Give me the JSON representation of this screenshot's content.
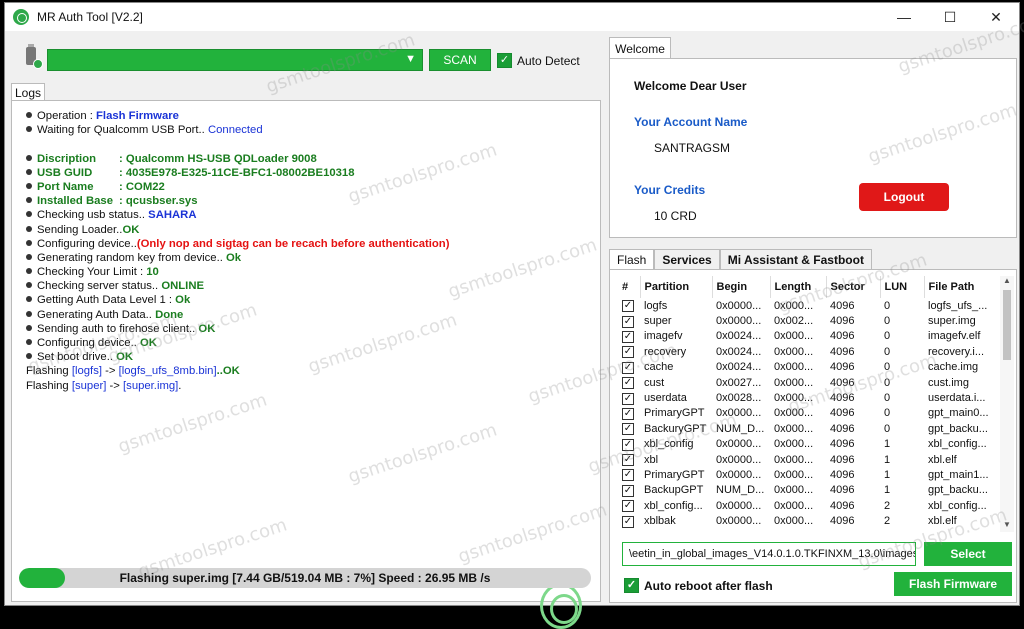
{
  "window": {
    "title": "MR Auth Tool [V2.2]",
    "minimize": "—",
    "maximize": "☐",
    "close": "✕"
  },
  "toolbar": {
    "scan_label": "SCAN",
    "auto_detect_label": "Auto Detect",
    "auto_detect_checked": true
  },
  "logs": {
    "tab_label": "Logs",
    "op_label": "Operation : ",
    "op_value": "Flash Firmware",
    "waiting_label": "Waiting for Qualcomm USB Port..",
    "waiting_value": "Connected",
    "desc_label": "Discription",
    "desc_value": ": Qualcomm HS-USB QDLoader 9008",
    "guid_label": "USB GUID",
    "guid_value": ": 4035E978-E325-11CE-BFC1-08002BE10318",
    "port_label": "Port Name",
    "port_value": ": COM22",
    "base_label": "Installed Base",
    "base_value": ": qcusbser.sys",
    "usb_status_label": "Checking usb status.. ",
    "usb_status_value": "SAHARA",
    "loader_label": "Sending Loader..",
    "loader_value": "OK",
    "config_label": "Configuring device..",
    "config_value": "(Only nop and sigtag can be recach before authentication)",
    "randkey_label": "Generating random key from device.. ",
    "randkey_value": "Ok",
    "limit_label": "Checking Your Limit : ",
    "limit_value": "10",
    "server_label": "Checking server status.. ",
    "server_value": "ONLINE",
    "authlvl_label": "Getting Auth Data Level 1 : ",
    "authlvl_value": "Ok",
    "gen_auth_label": "Generating Auth Data.. ",
    "gen_auth_value": "Done",
    "send_auth_label": "Sending auth to firehose client.. ",
    "send_auth_value": "OK",
    "config2_label": "Configuring device.. ",
    "config2_value": "OK",
    "boot_label": "Set boot drive.. ",
    "boot_value": "OK",
    "flash1_a": "Flashing ",
    "flash1_b": "[logfs]",
    "flash1_c": " -> ",
    "flash1_d": "[logfs_ufs_8mb.bin]",
    "flash1_e": "..OK",
    "flash2_a": "Flashing ",
    "flash2_b": "[super]",
    "flash2_c": " -> ",
    "flash2_d": "[super.img]",
    "flash2_e": "."
  },
  "progress": {
    "text": "Flashing super.img [7.44 GB/519.04 MB : 7%] Speed : 26.95 MB /s",
    "percent": 8
  },
  "welcome": {
    "tab_label": "Welcome",
    "greeting": "Welcome Dear User",
    "account_label": "Your Account Name",
    "account_value": "SANTRAGSM",
    "credits_label": "Your Credits",
    "credits_value": "10 CRD",
    "logout_label": "Logout"
  },
  "flash_tabs": [
    "Flash",
    "Services",
    "Mi Assistant & Fastboot"
  ],
  "partition_table": {
    "headers": [
      "#",
      "Partition",
      "Begin",
      "Length",
      "Sector",
      "LUN",
      "File Path"
    ],
    "rows": [
      [
        "logfs",
        "0x0000...",
        "0x000...",
        "4096",
        "0",
        "logfs_ufs_..."
      ],
      [
        "super",
        "0x0000...",
        "0x002...",
        "4096",
        "0",
        "super.img"
      ],
      [
        "imagefv",
        "0x0024...",
        "0x000...",
        "4096",
        "0",
        "imagefv.elf"
      ],
      [
        "recovery",
        "0x0024...",
        "0x000...",
        "4096",
        "0",
        "recovery.i..."
      ],
      [
        "cache",
        "0x0024...",
        "0x000...",
        "4096",
        "0",
        "cache.img"
      ],
      [
        "cust",
        "0x0027...",
        "0x000...",
        "4096",
        "0",
        "cust.img"
      ],
      [
        "userdata",
        "0x0028...",
        "0x000...",
        "4096",
        "0",
        "userdata.i..."
      ],
      [
        "PrimaryGPT",
        "0x0000...",
        "0x000...",
        "4096",
        "0",
        "gpt_main0..."
      ],
      [
        "BackuryGPT",
        "NUM_D...",
        "0x000...",
        "4096",
        "0",
        "gpt_backu..."
      ],
      [
        "xbl_config",
        "0x0000...",
        "0x000...",
        "4096",
        "1",
        "xbl_config..."
      ],
      [
        "xbl",
        "0x0000...",
        "0x000...",
        "4096",
        "1",
        "xbl.elf"
      ],
      [
        "PrimaryGPT",
        "0x0000...",
        "0x000...",
        "4096",
        "1",
        "gpt_main1..."
      ],
      [
        "BackupGPT",
        "NUM_D...",
        "0x000...",
        "4096",
        "1",
        "gpt_backu..."
      ],
      [
        "xbl_config...",
        "0x0000...",
        "0x000...",
        "4096",
        "2",
        "xbl_config..."
      ],
      [
        "xblbak",
        "0x0000...",
        "0x000...",
        "4096",
        "2",
        "xbl.elf"
      ]
    ]
  },
  "firmware_path": "\\eetin_in_global_images_V14.0.1.0.TKFINXM_13.0\\images",
  "select_label": "Select",
  "auto_reboot_label": "Auto reboot after flash",
  "flash_firmware_label": "Flash Firmware",
  "watermark": "gsmtoolspro.com",
  "colors": {
    "accent": "#22b23c",
    "logout": "#e01818",
    "label_blue": "#1a5bc8"
  }
}
